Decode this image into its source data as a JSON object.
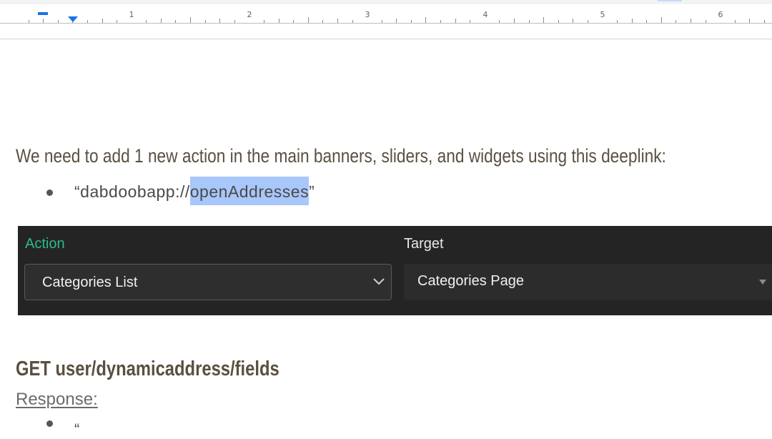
{
  "ruler": {
    "numbers": [
      "1",
      "2",
      "3",
      "4",
      "5",
      "6"
    ]
  },
  "document": {
    "paragraph": "We need to add 1 new action in the main banners, sliders, and widgets using this deeplink:",
    "bullet": {
      "prefix": "“dabdoobapp://",
      "selected": "openAddresses",
      "suffix": "”"
    },
    "heading": "GET user/dynamicaddress/fields",
    "response_label": "Response:",
    "next_bullet_partial": "“"
  },
  "panel": {
    "action_label": "Action",
    "target_label": "Target",
    "action_value": "Categories List",
    "target_value": "Categories Page",
    "action_label_color": "#2dba8a",
    "background": "#242424"
  },
  "colors": {
    "selection": "#a8c7fa",
    "ruler_accent": "#1a73e8",
    "body_text": "#5a5040"
  }
}
